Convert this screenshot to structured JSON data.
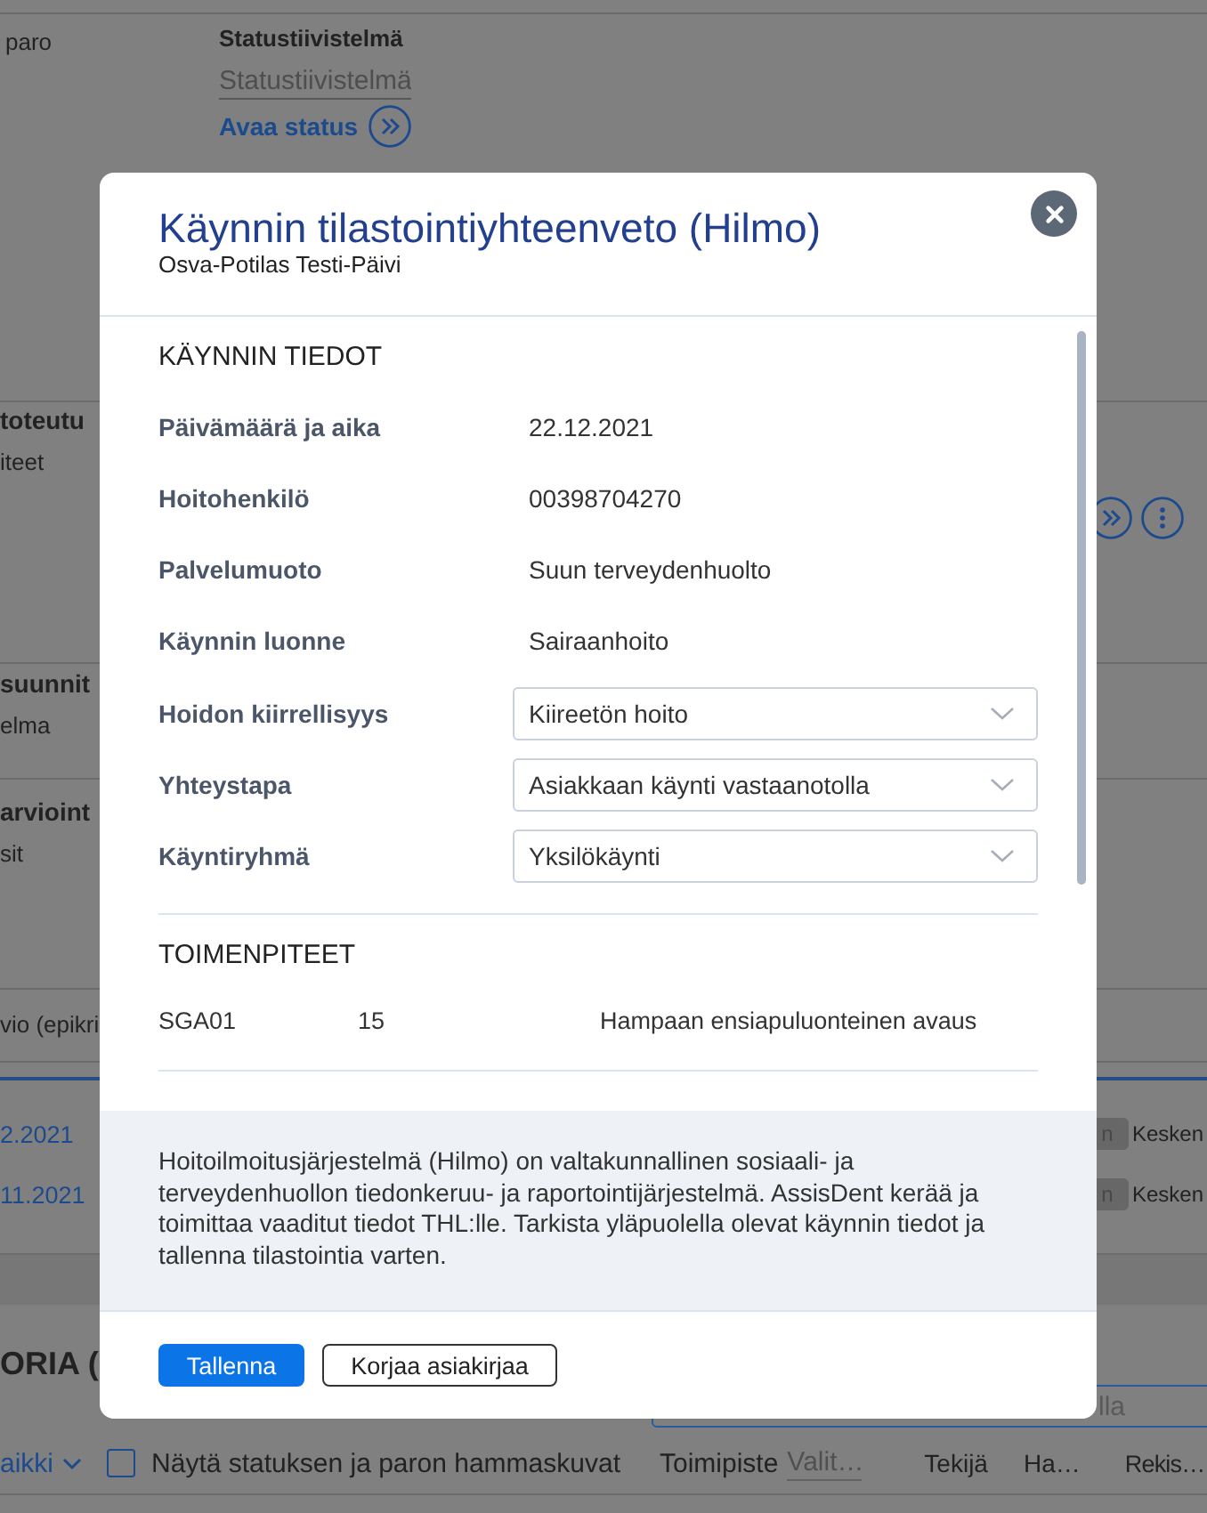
{
  "background": {
    "status_block": {
      "side_label": "paro",
      "heading": "Statustiivistelmä",
      "summary_field": {
        "placeholder": "Statustiivistelmä"
      },
      "link": "Avaa status"
    },
    "sections": [
      {
        "kind": "actions",
        "title": "toteutu",
        "subtitle": "iteet"
      },
      {
        "kind": "plain",
        "title": "suunnit",
        "subtitle": "elma"
      },
      {
        "kind": "plain",
        "title": "arvioint",
        "subtitle": "sit"
      },
      {
        "kind": "row",
        "title": "vio (epikri"
      }
    ],
    "visits": [
      {
        "date": "2.2021",
        "badge": "n",
        "status": "Kesken"
      },
      {
        "date": "11.2021",
        "badge": "n",
        "status": "Kesken"
      }
    ],
    "history": {
      "title": "ORIA (",
      "search": {
        "placeholder": "lla"
      },
      "period": "aikki",
      "checkbox": {
        "label": "Näytä statuksen ja paron hammaskuvat",
        "checked": false
      },
      "office": {
        "label": "Toimipiste",
        "placeholder": "Valit…"
      },
      "columns": [
        "Tekijä",
        "Ha…",
        "Rekis…"
      ]
    }
  },
  "dialog": {
    "title": "Käynnin tilastointiyhteenveto (Hilmo)",
    "subtitle": "Osva-Potilas Testi-Päivi",
    "visit_section": {
      "heading": "KÄYNNIN TIEDOT",
      "fields": [
        {
          "kind": "text",
          "label": "Päivämäärä ja aika",
          "value": "22.12.2021"
        },
        {
          "kind": "text",
          "label": "Hoitohenkilö",
          "value": "00398704270"
        },
        {
          "kind": "text",
          "label": "Palvelumuoto",
          "value": "Suun terveydenhuolto"
        },
        {
          "kind": "text",
          "label": "Käynnin luonne",
          "value": "Sairaanhoito"
        },
        {
          "kind": "select",
          "label": "Hoidon kiirrellisyys",
          "value": "Kiireetön hoito"
        },
        {
          "kind": "select",
          "label": "Yhteystapa",
          "value": "Asiakkaan käynti vastaanotolla"
        },
        {
          "kind": "select",
          "label": "Käyntiryhmä",
          "value": "Yksilökäynti"
        }
      ]
    },
    "procedures_section": {
      "heading": "TOIMENPITEET",
      "rows": [
        {
          "code": "SGA01",
          "count": "15",
          "description": "Hampaan ensiapuluonteinen avaus"
        }
      ]
    },
    "info": "Hoitoilmoitusjärjestelmä (Hilmo) on valtakunnallinen sosiaali- ja terveydenhuollon tiedonkeruu- ja raportointijärjestelmä. AssisDent kerää ja toimittaa vaaditut tiedot THL:lle. Tarkista yläpuolella olevat käynnin tiedot ja tallenna tilastointia varten.",
    "buttons": [
      {
        "kind": "primary",
        "label": "Tallenna"
      },
      {
        "kind": "secondary",
        "label": "Korjaa asiakirjaa"
      }
    ]
  }
}
